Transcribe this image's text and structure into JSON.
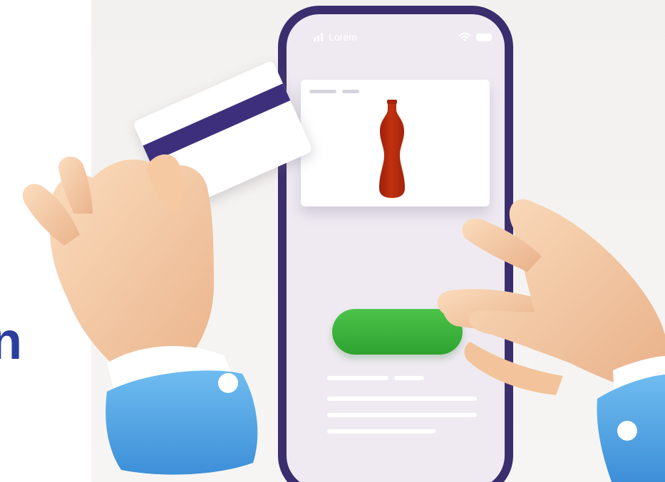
{
  "partial_text": "n",
  "phone": {
    "status_label": "Lorem"
  },
  "colors": {
    "phone_frame": "#3a2e6e",
    "screen": "#efeaf2",
    "button": "#3cb33b",
    "bottle": "#b2250e",
    "card_stripe": "#3e2f7c",
    "sleeve": "#4aa3e6",
    "skin": "#f6cfa8",
    "text_accent": "#2b3ea0"
  },
  "icons": {
    "signal": "signal-icon",
    "wifi": "wifi-icon",
    "battery": "battery-icon",
    "product": "bottle-icon"
  }
}
